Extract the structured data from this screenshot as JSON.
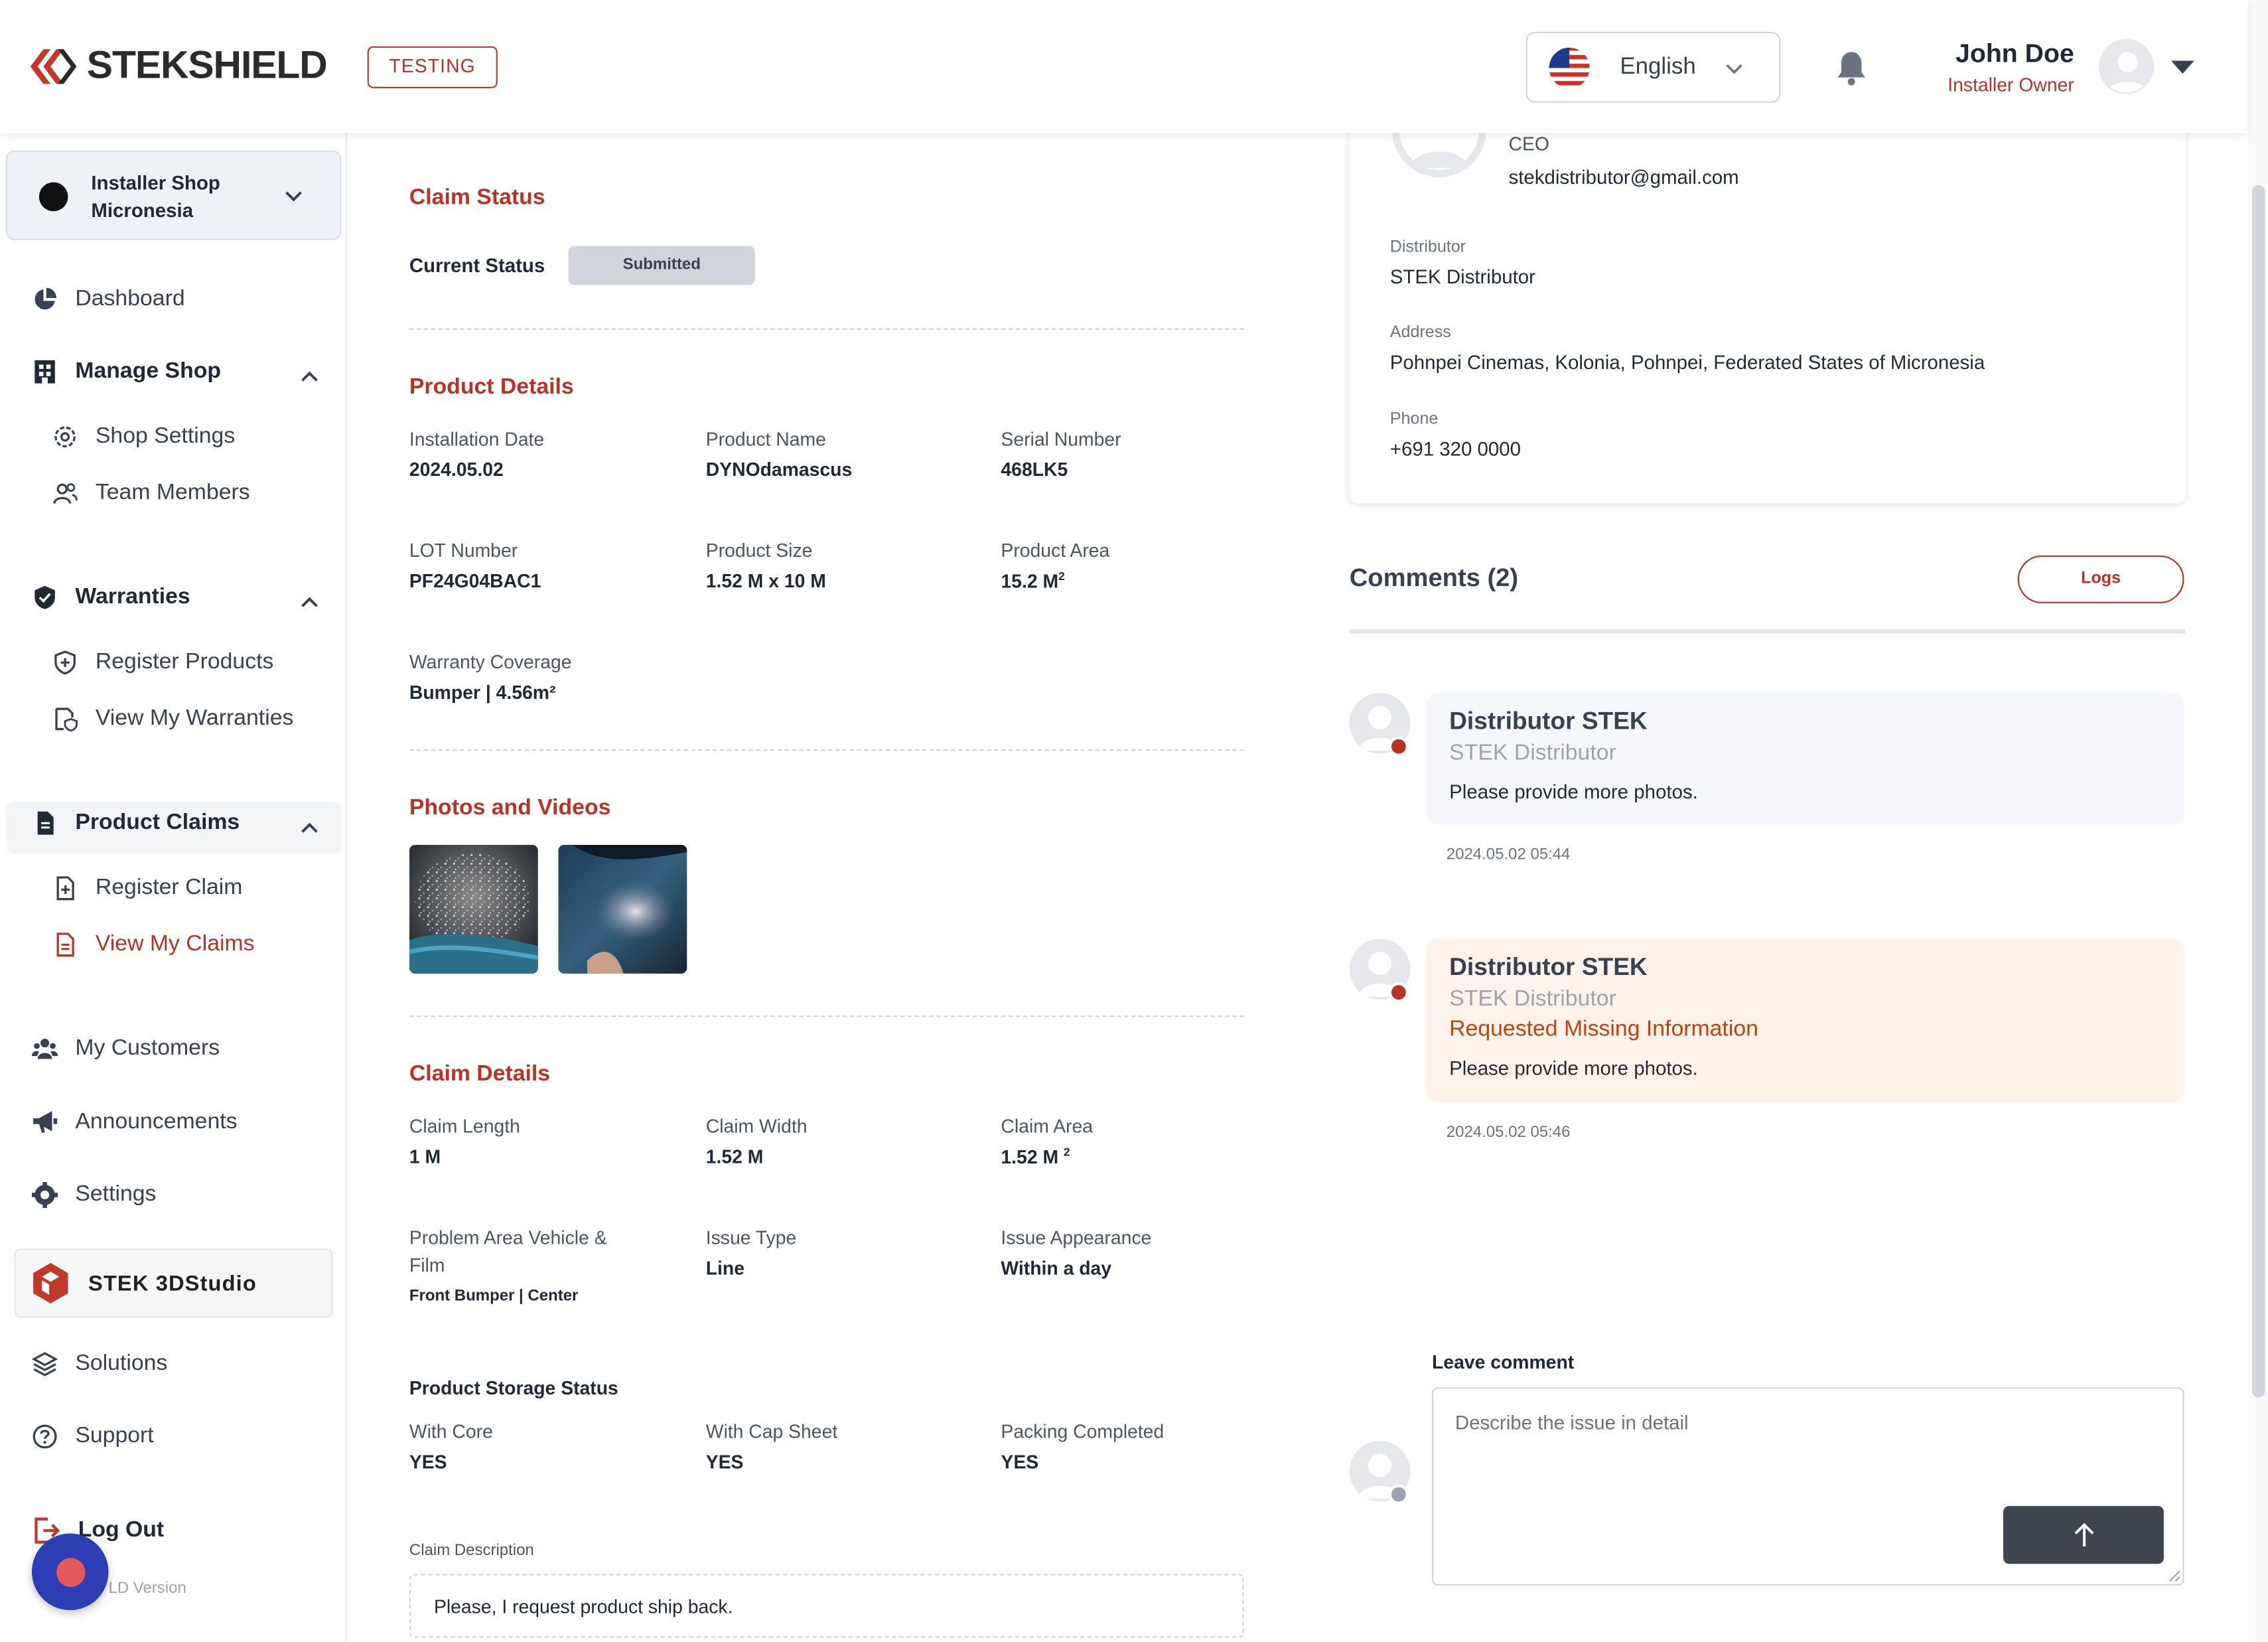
{
  "header": {
    "logo_text": "STEKSHIELD",
    "env_badge": "TESTING",
    "language": "English",
    "user_name": "John Doe",
    "user_role": "Installer Owner"
  },
  "sidebar": {
    "shop_name_line1": "Installer Shop",
    "shop_name_line2": "Micronesia",
    "items": {
      "dashboard": "Dashboard",
      "manage_shop": "Manage Shop",
      "shop_settings": "Shop Settings",
      "team_members": "Team Members",
      "warranties": "Warranties",
      "register_products": "Register Products",
      "view_warranties": "View My Warranties",
      "product_claims": "Product Claims",
      "register_claim": "Register Claim",
      "view_claims": "View My Claims",
      "my_customers": "My Customers",
      "announcements": "Announcements",
      "settings": "Settings",
      "studio": "STEK 3DStudio",
      "solutions": "Solutions",
      "support": "Support",
      "logout": "Log Out",
      "version": "LD Version"
    }
  },
  "claim_status": {
    "heading": "Claim Status",
    "label": "Current Status",
    "value": "Submitted"
  },
  "product_details": {
    "heading": "Product Details",
    "fields": [
      {
        "label": "Installation Date",
        "value": "2024.05.02"
      },
      {
        "label": "Product Name",
        "value": "DYNOdamascus"
      },
      {
        "label": "Serial Number",
        "value": "468LK5"
      },
      {
        "label": "LOT Number",
        "value": "PF24G04BAC1"
      },
      {
        "label": "Product Size",
        "value": "1.52 M x 10 M"
      },
      {
        "label": "Product Area",
        "value": "15.2 M",
        "sup": "2"
      },
      {
        "label": "Warranty Coverage",
        "value": "Bumper | 4.56m²"
      }
    ]
  },
  "photos": {
    "heading": "Photos and Videos"
  },
  "claim_details": {
    "heading": "Claim Details",
    "fields": [
      {
        "label": "Claim Length",
        "value": "1 M"
      },
      {
        "label": "Claim Width",
        "value": "1.52 M"
      },
      {
        "label": "Claim Area",
        "value": "1.52 M ",
        "sup": "2"
      },
      {
        "label": "Problem Area Vehicle & Film",
        "value": "Front Bumper | Center"
      },
      {
        "label": "Issue Type",
        "value": "Line"
      },
      {
        "label": "Issue Appearance",
        "value": "Within a day"
      }
    ],
    "storage_heading": "Product Storage Status",
    "storage": [
      {
        "label": "With Core",
        "value": "YES"
      },
      {
        "label": "With Cap Sheet",
        "value": "YES"
      },
      {
        "label": "Packing Completed",
        "value": "YES"
      }
    ],
    "description_label": "Claim Description",
    "description": "Please, I request product ship back."
  },
  "distributor": {
    "title": "CEO",
    "email": "stekdistributor@gmail.com",
    "distributor_label": "Distributor",
    "distributor": "STEK Distributor",
    "address_label": "Address",
    "address": "Pohnpei Cinemas, Kolonia, Pohnpei, Federated States of Micronesia",
    "phone_label": "Phone",
    "phone": "+691 320 0000"
  },
  "comments": {
    "title": "Comments (2)",
    "logs_label": "Logs",
    "items": [
      {
        "name": "Distributor STEK",
        "org": "STEK Distributor",
        "text": "Please provide more photos.",
        "time": "2024.05.02 05:44"
      },
      {
        "name": "Distributor STEK",
        "org": "STEK Distributor",
        "flag": "Requested Missing Information",
        "text": "Please provide more photos.",
        "time": "2024.05.02 05:46"
      }
    ],
    "leave_label": "Leave comment",
    "placeholder": "Describe the issue in detail"
  },
  "colors": {
    "brand_red": "#b83226",
    "warning_bg": "#fdf3ea",
    "bubble_bg": "#f5f7fa",
    "send_button": "#3f4650",
    "chat_fab": "#2f3db5"
  }
}
